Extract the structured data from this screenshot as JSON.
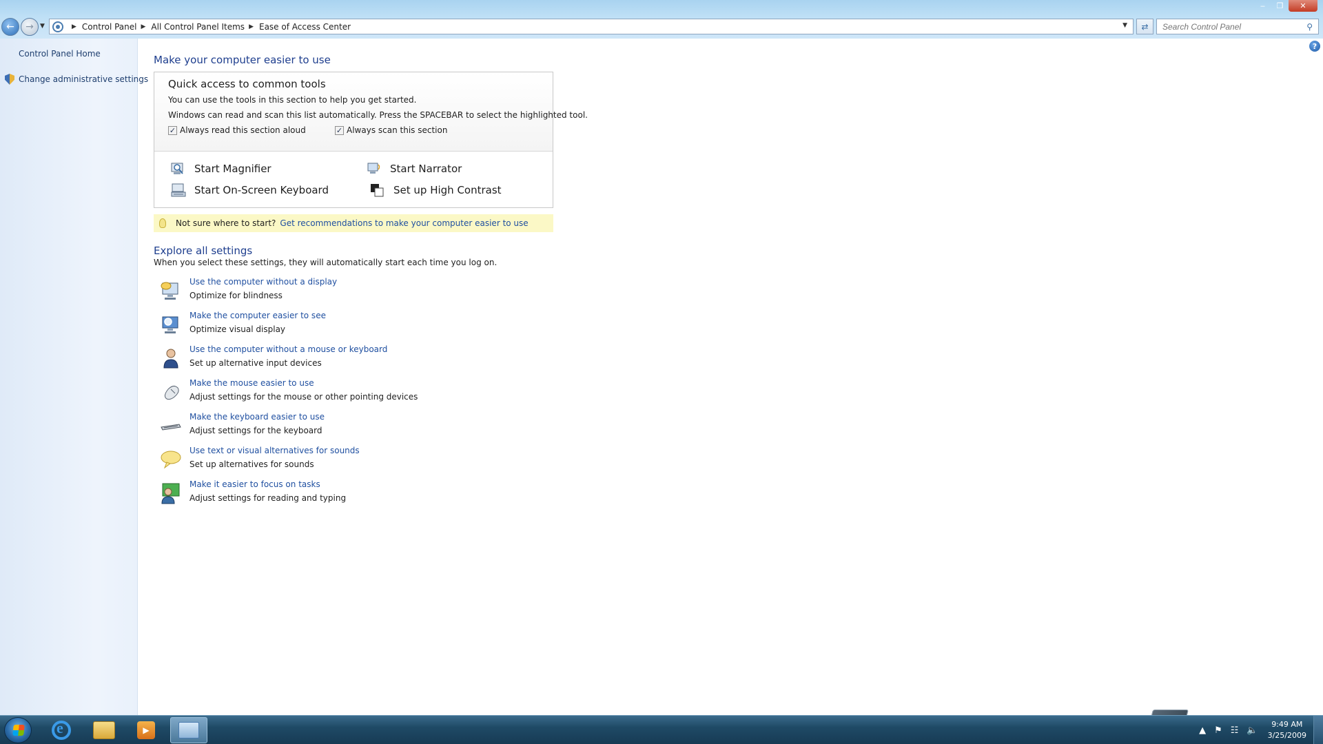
{
  "window": {
    "minimize_glyph": "‒",
    "maximize_glyph": "❐",
    "close_glyph": "✕"
  },
  "address": {
    "breadcrumbs": [
      "Control Panel",
      "All Control Panel Items",
      "Ease of Access Center"
    ],
    "search_placeholder": "Search Control Panel"
  },
  "left_pane": {
    "links": [
      "Control Panel Home",
      "Change administrative settings"
    ]
  },
  "main": {
    "heading": "Make your computer easier to use",
    "quick_access": {
      "title": "Quick access to common tools",
      "line1": "You can use the tools in this section to help you get started.",
      "line2": "Windows can read and scan this list automatically.  Press the SPACEBAR to select the highlighted tool.",
      "checkbox_read": {
        "label": "Always read this section aloud",
        "checked": true
      },
      "checkbox_scan": {
        "label": "Always scan this section",
        "checked": true
      },
      "tools": [
        "Start Magnifier",
        "Start Narrator",
        "Start On-Screen Keyboard",
        "Set up High Contrast"
      ]
    },
    "tip": {
      "text": "Not sure where to start?",
      "link": "Get recommendations to make your computer easier to use"
    },
    "explore": {
      "heading": "Explore all settings",
      "subtext": "When you select these settings, they will automatically start each time you log on.",
      "items": [
        {
          "link": "Use the computer without a display",
          "desc": "Optimize for blindness",
          "icon": "monitor-speaker-icon"
        },
        {
          "link": "Make the computer easier to see",
          "desc": "Optimize visual display",
          "icon": "monitor-magnify-icon"
        },
        {
          "link": "Use the computer without a mouse or keyboard",
          "desc": "Set up alternative input devices",
          "icon": "user-icon"
        },
        {
          "link": "Make the mouse easier to use",
          "desc": "Adjust settings for the mouse or other pointing devices",
          "icon": "mouse-icon"
        },
        {
          "link": "Make the keyboard easier to use",
          "desc": "Adjust settings for the keyboard",
          "icon": "keyboard-icon"
        },
        {
          "link": "Use text or visual alternatives for sounds",
          "desc": "Set up alternatives for sounds",
          "icon": "speech-bubble-icon"
        },
        {
          "link": "Make it easier to focus on tasks",
          "desc": "Adjust settings for reading and typing",
          "icon": "users-focus-icon"
        }
      ]
    }
  },
  "taskbar": {
    "time": "9:49 AM",
    "date": "3/25/2009"
  },
  "colors": {
    "link": "#1f4fa0",
    "heading": "#1e3e8e",
    "tip_background": "#fbf8c6",
    "taskbar": "#1f4a66"
  }
}
